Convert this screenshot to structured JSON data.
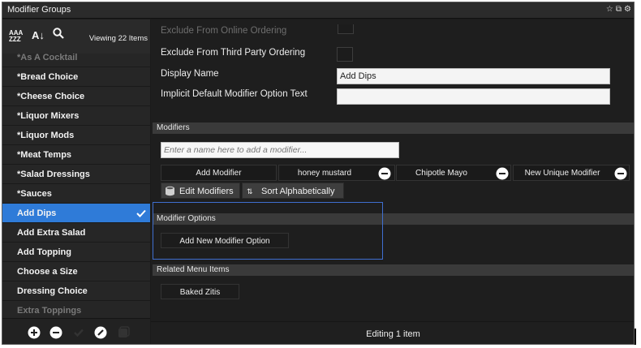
{
  "window": {
    "title": "Modifier Groups"
  },
  "sidebar": {
    "viewing_text": "Viewing 22 Items",
    "items": [
      {
        "label": "*As A Cocktail",
        "faded": true
      },
      {
        "label": "*Bread Choice"
      },
      {
        "label": "*Cheese Choice"
      },
      {
        "label": "*Liquor Mixers"
      },
      {
        "label": "*Liquor Mods"
      },
      {
        "label": "*Meat Temps"
      },
      {
        "label": "*Salad Dressings"
      },
      {
        "label": "*Sauces"
      },
      {
        "label": "Add Dips",
        "selected": true
      },
      {
        "label": "Add Extra Salad"
      },
      {
        "label": "Add Topping"
      },
      {
        "label": "Choose a Size"
      },
      {
        "label": "Dressing Choice"
      },
      {
        "label": "Extra Toppings",
        "faded": true
      }
    ],
    "toolbar_icons": [
      "sort-alpha-icon",
      "sort-az-icon",
      "search-icon"
    ],
    "bottom_icons": [
      "add-icon",
      "remove-icon",
      "check-icon",
      "edit-icon",
      "copy-icon"
    ]
  },
  "form": {
    "exclude_online_label": "Exclude From Online Ordering",
    "exclude_third_party_label": "Exclude From Third Party Ordering",
    "display_name_label": "Display Name",
    "display_name_value": "Add Dips",
    "implicit_default_label": "Implicit Default Modifier Option Text",
    "implicit_default_value": ""
  },
  "modifiers": {
    "section_title": "Modifiers",
    "input_placeholder": "Enter a name here to add a modifier...",
    "add_modifier_label": "Add Modifier",
    "chips": [
      {
        "label": "honey mustard"
      },
      {
        "label": "Chipotle Mayo"
      },
      {
        "label": "New Unique Modifier"
      }
    ],
    "edit_button": "Edit Modifiers",
    "sort_button": "Sort Alphabetically"
  },
  "modifier_options": {
    "section_title": "Modifier Options",
    "add_button": "Add New Modifier Option"
  },
  "related": {
    "section_title": "Related Menu Items",
    "items": [
      "Baked Zitis"
    ]
  },
  "footer": {
    "status": "Editing 1 item"
  },
  "colors": {
    "selected": "#2f7bd8",
    "highlight_border": "#3f6fd0",
    "background": "#1e1e1e"
  }
}
